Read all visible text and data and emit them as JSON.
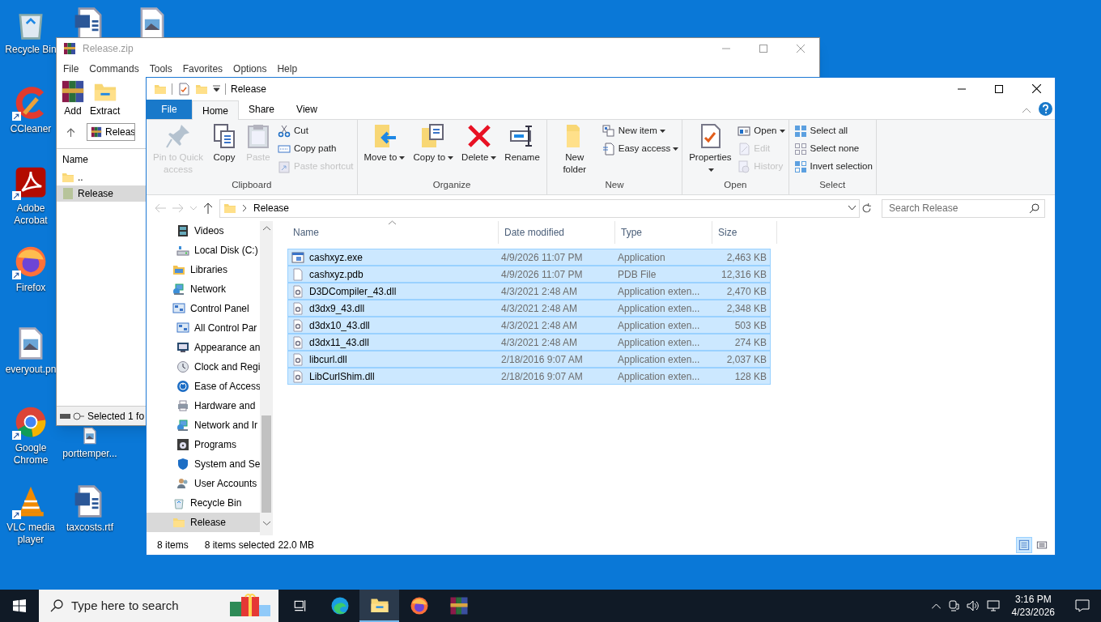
{
  "desktop_icons": [
    {
      "label": "Recycle Bin",
      "kind": "recycle",
      "shortcut": false
    },
    {
      "kind": "word",
      "shortcut": false
    },
    {
      "kind": "image",
      "shortcut": false
    },
    {
      "label": "CCleaner",
      "kind": "ccleaner",
      "shortcut": true
    },
    {
      "label": "Adobe Acrobat",
      "kind": "acrobat",
      "shortcut": true
    },
    {
      "label": "Firefox",
      "kind": "firefox",
      "shortcut": true
    },
    {
      "label": "everyout.pn",
      "kind": "image",
      "shortcut": false
    },
    {
      "label": "Google Chrome",
      "kind": "chrome",
      "shortcut": true
    },
    {
      "label": "porttemper...",
      "kind": "image",
      "shortcut": false
    },
    {
      "label": "VLC media player",
      "kind": "vlc",
      "shortcut": true
    },
    {
      "label": "taxcosts.rtf",
      "kind": "word",
      "shortcut": false
    }
  ],
  "archiver": {
    "title": "Release.zip",
    "menu": [
      "File",
      "Commands",
      "Tools",
      "Favorites",
      "Options",
      "Help"
    ],
    "toolbar": [
      "Add",
      "Extract"
    ],
    "path": "Releas",
    "column": "Name",
    "rows": [
      {
        "name": "..",
        "kind": "up",
        "selected": false
      },
      {
        "name": "Release",
        "kind": "folder",
        "selected": true
      }
    ],
    "status": "Selected 1 fo"
  },
  "explorer": {
    "title": "Release",
    "tabs": [
      {
        "label": "File",
        "kind": "file",
        "selected": false
      },
      {
        "label": "Home",
        "kind": "tab",
        "selected": true
      },
      {
        "label": "Share",
        "kind": "tab",
        "selected": false
      },
      {
        "label": "View",
        "kind": "tab",
        "selected": false
      }
    ],
    "ribbon": [
      {
        "name": "Clipboard",
        "buttons": [
          {
            "label": "Pin to Quick access",
            "kind": "large",
            "disabled": true,
            "dropdown": false
          },
          {
            "label": "Copy",
            "kind": "large",
            "disabled": false,
            "dropdown": false
          },
          {
            "label": "Paste",
            "kind": "large",
            "disabled": true,
            "dropdown": false
          },
          {
            "label": "Cut",
            "kind": "small",
            "disabled": false,
            "dropdown": false
          },
          {
            "label": "Copy path",
            "kind": "small",
            "disabled": false,
            "dropdown": false
          },
          {
            "label": "Paste shortcut",
            "kind": "small",
            "disabled": true,
            "dropdown": false
          }
        ]
      },
      {
        "name": "Organize",
        "buttons": [
          {
            "label": "Move to",
            "kind": "large",
            "disabled": false,
            "dropdown": true
          },
          {
            "label": "Copy to",
            "kind": "large",
            "disabled": false,
            "dropdown": true
          },
          {
            "label": "Delete",
            "kind": "large",
            "disabled": false,
            "dropdown": true
          },
          {
            "label": "Rename",
            "kind": "large",
            "disabled": false,
            "dropdown": false
          }
        ]
      },
      {
        "name": "New",
        "buttons": [
          {
            "label": "New folder",
            "kind": "large",
            "disabled": false,
            "dropdown": false
          },
          {
            "label": "New item",
            "kind": "small",
            "disabled": false,
            "dropdown": true
          },
          {
            "label": "Easy access",
            "kind": "small",
            "disabled": false,
            "dropdown": true
          }
        ]
      },
      {
        "name": "Open",
        "buttons": [
          {
            "label": "Properties",
            "kind": "large",
            "disabled": false,
            "dropdown": true
          },
          {
            "label": "Open",
            "kind": "small",
            "disabled": false,
            "dropdown": true
          },
          {
            "label": "Edit",
            "kind": "small",
            "disabled": true,
            "dropdown": false
          },
          {
            "label": "History",
            "kind": "small",
            "disabled": true,
            "dropdown": false
          }
        ]
      },
      {
        "name": "Select",
        "buttons": [
          {
            "label": "Select all",
            "kind": "small",
            "disabled": false,
            "dropdown": false
          },
          {
            "label": "Select none",
            "kind": "small",
            "disabled": false,
            "dropdown": false
          },
          {
            "label": "Invert selection",
            "kind": "small",
            "disabled": false,
            "dropdown": false
          }
        ]
      }
    ],
    "address": "Release",
    "search": {
      "placeholder": "Search Release"
    },
    "nav": {
      "continued_children": [
        {
          "label": "Videos",
          "kind": "videos",
          "selected": false
        },
        {
          "label": "Local Disk (C:)",
          "kind": "disk",
          "selected": false
        }
      ],
      "items": [
        {
          "label": "Libraries",
          "kind": "libraries",
          "selected": false
        },
        {
          "label": "Network",
          "kind": "network",
          "selected": false
        },
        {
          "label": "Control Panel",
          "kind": "control",
          "selected": false,
          "children": [
            {
              "label": "All Control Par",
              "kind": "control",
              "selected": false
            },
            {
              "label": "Appearance an",
              "kind": "appearance",
              "selected": false
            },
            {
              "label": "Clock and Regi",
              "kind": "clock",
              "selected": false
            },
            {
              "label": "Ease of Access",
              "kind": "ease",
              "selected": false
            },
            {
              "label": "Hardware and",
              "kind": "hardware",
              "selected": false
            },
            {
              "label": "Network and Ir",
              "kind": "network",
              "selected": false
            },
            {
              "label": "Programs",
              "kind": "programs",
              "selected": false
            },
            {
              "label": "System and Se",
              "kind": "shield",
              "selected": false
            },
            {
              "label": "User Accounts",
              "kind": "users",
              "selected": false
            }
          ]
        },
        {
          "label": "Recycle Bin",
          "kind": "recycle",
          "selected": false
        },
        {
          "label": "Release",
          "kind": "folder",
          "selected": true
        }
      ]
    },
    "columns": [
      "Name",
      "Date modified",
      "Type",
      "Size"
    ],
    "files": [
      {
        "name": "cashxyz.exe",
        "date": "4/9/2026 11:07 PM",
        "type": "Application",
        "size": "2,463 KB",
        "kind": "exe",
        "selected": true
      },
      {
        "name": "cashxyz.pdb",
        "date": "4/9/2026 11:07 PM",
        "type": "PDB File",
        "size": "12,316 KB",
        "kind": "file",
        "selected": true
      },
      {
        "name": "D3DCompiler_43.dll",
        "date": "4/3/2021 2:48 AM",
        "type": "Application exten...",
        "size": "2,470 KB",
        "kind": "dll",
        "selected": true
      },
      {
        "name": "d3dx9_43.dll",
        "date": "4/3/2021 2:48 AM",
        "type": "Application exten...",
        "size": "2,348 KB",
        "kind": "dll",
        "selected": true
      },
      {
        "name": "d3dx10_43.dll",
        "date": "4/3/2021 2:48 AM",
        "type": "Application exten...",
        "size": "503 KB",
        "kind": "dll",
        "selected": true
      },
      {
        "name": "d3dx11_43.dll",
        "date": "4/3/2021 2:48 AM",
        "type": "Application exten...",
        "size": "274 KB",
        "kind": "dll",
        "selected": true
      },
      {
        "name": "libcurl.dll",
        "date": "2/18/2016 9:07 AM",
        "type": "Application exten...",
        "size": "2,037 KB",
        "kind": "dll",
        "selected": true
      },
      {
        "name": "LibCurlShim.dll",
        "date": "2/18/2016 9:07 AM",
        "type": "Application exten...",
        "size": "128 KB",
        "kind": "dll",
        "selected": true
      }
    ],
    "status": {
      "count": "8 items",
      "selection": "8 items selected",
      "total": "22.0 MB"
    },
    "views": [
      {
        "kind": "details",
        "selected": true
      },
      {
        "kind": "tiles",
        "selected": false
      }
    ]
  },
  "taskbar": {
    "search_placeholder": "Type here to search",
    "apps": [
      {
        "kind": "taskview",
        "active": false
      },
      {
        "kind": "edge",
        "active": false
      },
      {
        "kind": "explorer",
        "active": true
      },
      {
        "kind": "firefox",
        "active": false
      },
      {
        "kind": "winrar",
        "active": false
      }
    ],
    "time": "3:16 PM",
    "date": "4/23/2026"
  }
}
